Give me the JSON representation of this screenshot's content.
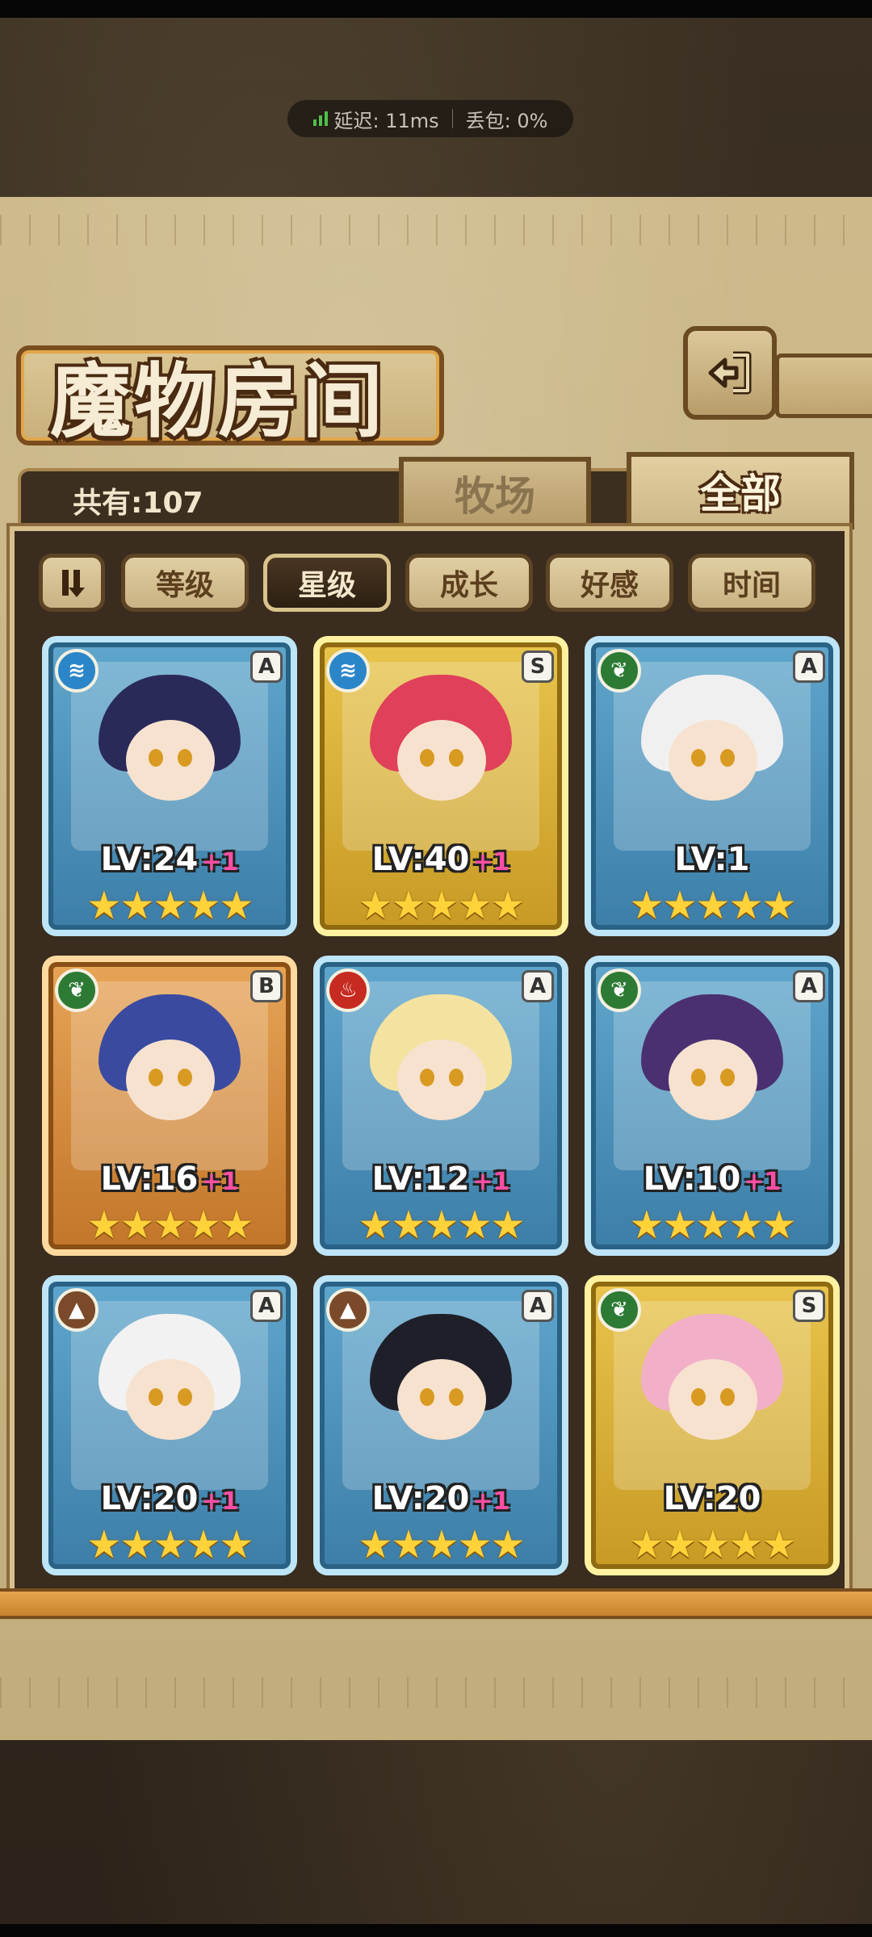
{
  "status": {
    "latency": "延迟: 11ms",
    "packet_loss": "丢包: 0%"
  },
  "header": {
    "title": "魔物房间"
  },
  "summary": {
    "count": "共有:107"
  },
  "tabs": [
    {
      "label": "牧场"
    },
    {
      "label": "全部"
    }
  ],
  "filters": [
    {
      "label": "等级"
    },
    {
      "label": "星级"
    },
    {
      "label": "成长"
    },
    {
      "label": "好感"
    },
    {
      "label": "时间"
    }
  ],
  "active_filter": "星级",
  "monsters": [
    {
      "level": "LV:24",
      "bonus": "+1",
      "rank": "A",
      "element": "water",
      "stars": "★★★★★",
      "frame": "blue"
    },
    {
      "level": "LV:40",
      "bonus": "+1",
      "rank": "S",
      "element": "water",
      "stars": "★★★★★",
      "frame": "gold"
    },
    {
      "level": "LV:1",
      "bonus": "",
      "rank": "A",
      "element": "leaf",
      "stars": "★★★★★",
      "frame": "blue"
    },
    {
      "level": "LV:16",
      "bonus": "+1",
      "rank": "B",
      "element": "leaf",
      "stars": "★★★★★",
      "frame": "orange"
    },
    {
      "level": "LV:12",
      "bonus": "+1",
      "rank": "A",
      "element": "fire",
      "stars": "★★★★★",
      "frame": "blue"
    },
    {
      "level": "LV:10",
      "bonus": "+1",
      "rank": "A",
      "element": "leaf",
      "stars": "★★★★★",
      "frame": "blue"
    },
    {
      "level": "LV:20",
      "bonus": "+1",
      "rank": "A",
      "element": "earth",
      "stars": "★★★★★",
      "frame": "blue"
    },
    {
      "level": "LV:20",
      "bonus": "+1",
      "rank": "A",
      "element": "earth",
      "stars": "★★★★★",
      "frame": "blue"
    },
    {
      "level": "LV:20",
      "bonus": "",
      "rank": "S",
      "element": "leaf",
      "stars": "★★★★★",
      "frame": "gold"
    }
  ]
}
